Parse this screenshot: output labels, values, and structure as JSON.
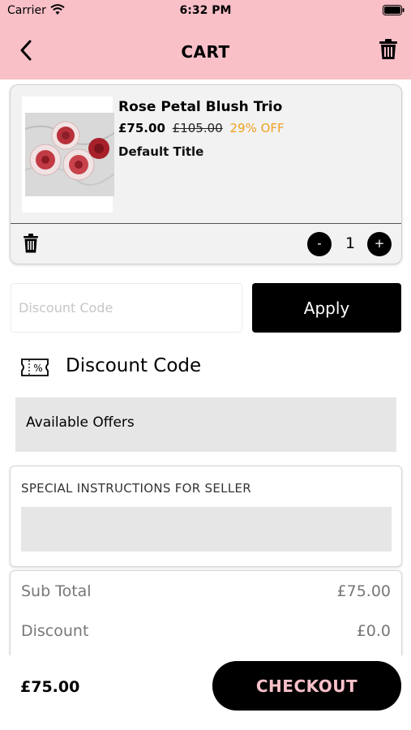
{
  "status_bar": {
    "carrier": "Carrier",
    "time": "6:32 PM"
  },
  "header": {
    "title": "CART",
    "background": "#f9c0c8"
  },
  "icons": {
    "back": "chevron-left-icon",
    "clear_cart": "trash-icon",
    "remove_item": "trash-icon",
    "coupon": "coupon-percent-icon",
    "product_image": "rose-boxes-image"
  },
  "cart_item": {
    "name": "Rose Petal Blush Trio",
    "price": "£75.00",
    "original_price": "£105.00",
    "discount_percent": "29% OFF",
    "variant": "Default Title",
    "quantity": "1",
    "qty_minus": "-",
    "qty_plus": "+"
  },
  "discount": {
    "placeholder": "Discount Code",
    "apply_label": "Apply",
    "heading": "Discount Code",
    "offers_label": "Available Offers"
  },
  "instructions": {
    "label": "SPECIAL INSTRUCTIONS FOR SELLER"
  },
  "totals": {
    "sub_total_label": "Sub Total",
    "sub_total_value": "£75.00",
    "discount_label": "Discount",
    "discount_value": "£0.0"
  },
  "footer": {
    "total": "£75.00",
    "checkout_label": "CHECKOUT"
  },
  "colors": {
    "accent": "#f9c0c8",
    "off_badge": "#f0a020",
    "button": "#000000"
  }
}
